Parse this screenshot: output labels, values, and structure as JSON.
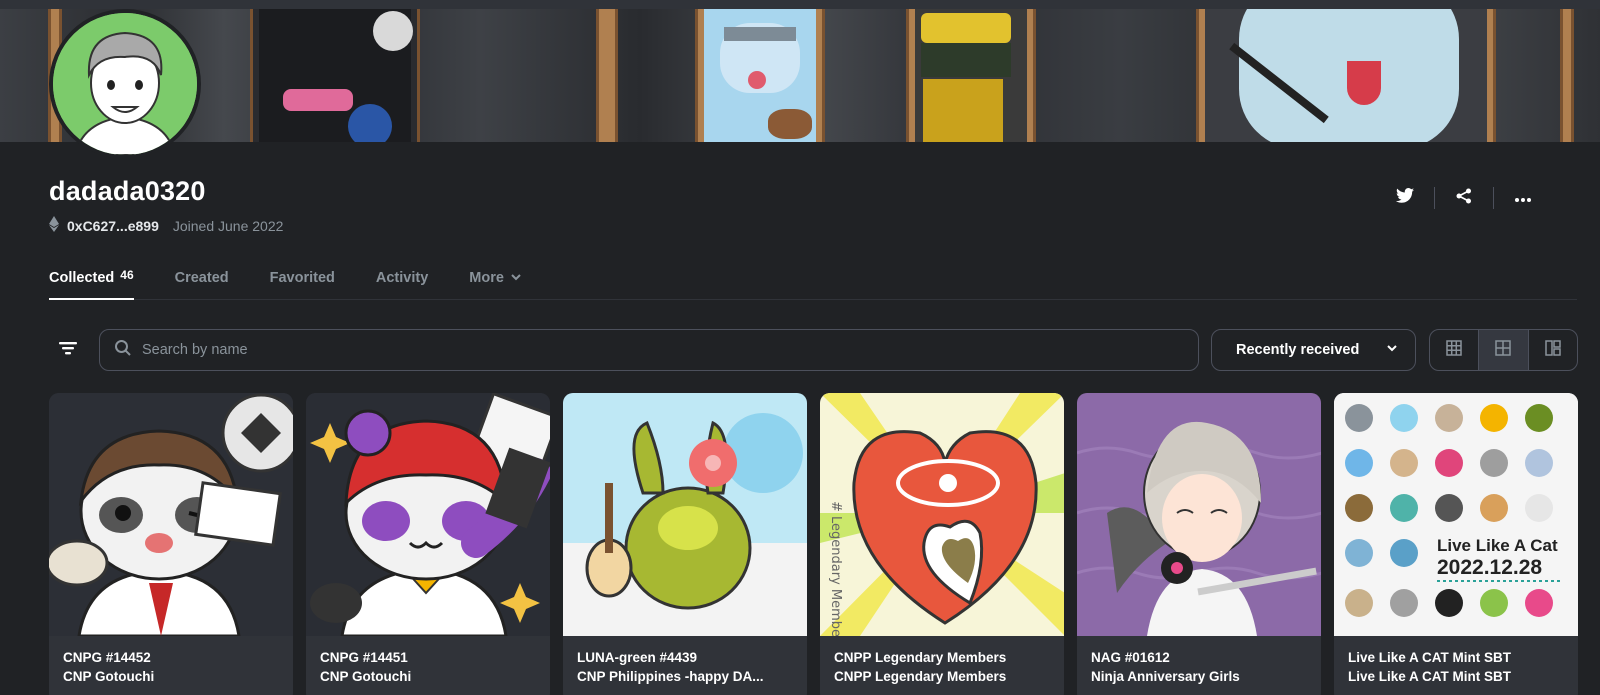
{
  "profile": {
    "username": "dadada0320",
    "address": "0xC627...e899",
    "joined": "Joined June 2022"
  },
  "tabs": [
    {
      "label": "Collected",
      "count": "46"
    },
    {
      "label": "Created"
    },
    {
      "label": "Favorited"
    },
    {
      "label": "Activity"
    },
    {
      "label": "More"
    }
  ],
  "toolbar": {
    "search_placeholder": "Search by name",
    "sort_label": "Recently received"
  },
  "cards": [
    {
      "name": "CNPG #14452",
      "collection": "CNP Gotouchi"
    },
    {
      "name": "CNPG #14451",
      "collection": "CNP Gotouchi"
    },
    {
      "name": "LUNA-green #4439",
      "collection": "CNP Philippines -happy DA..."
    },
    {
      "name": "CNPP Legendary Members",
      "collection": "CNPP Legendary Members"
    },
    {
      "name": "NAG #01612",
      "collection": "Ninja Anniversary Girls"
    },
    {
      "name": "Live Like A CAT Mint SBT",
      "collection": "Live Like A CAT Mint SBT"
    }
  ],
  "artwork_text": {
    "cat_title": "Live Like A Cat",
    "cat_date": "2022.12.28",
    "legendary": "# Legendary Members"
  },
  "icons": [
    "ethereum-icon",
    "twitter-icon",
    "share-icon",
    "more-icon",
    "filter-icon",
    "search-icon",
    "chevron-down-icon",
    "grid-large-icon",
    "grid-medium-icon",
    "grid-mosaic-icon"
  ],
  "colors": {
    "background": "#202225",
    "card": "#303339",
    "border": "#4c505c",
    "muted": "#8a939b"
  }
}
